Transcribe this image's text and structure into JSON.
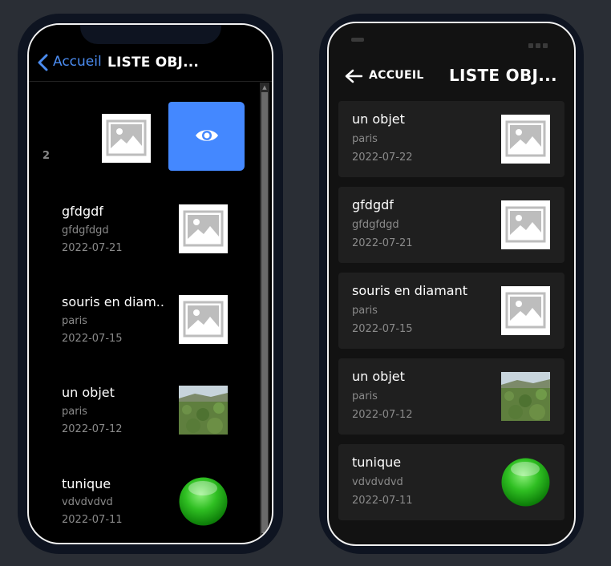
{
  "ios": {
    "back_label": "Accueil",
    "title": "LISTE OBJ...",
    "swipe_badge": "2",
    "items": [
      {
        "title": "gfdgdf",
        "subtitle": "gfdgfdgd",
        "date": "2022-07-21",
        "thumb": "placeholder-image"
      },
      {
        "title": "souris en diam...",
        "subtitle": "paris",
        "date": "2022-07-15",
        "thumb": "placeholder-image"
      },
      {
        "title": "un objet",
        "subtitle": "paris",
        "date": "2022-07-12",
        "thumb": "landscape-photo"
      },
      {
        "title": "tunique",
        "subtitle": "vdvdvdvd",
        "date": "2022-07-11",
        "thumb": "green-ball"
      }
    ],
    "swipe_icon": "eye-icon",
    "accent_color": "#4488ff"
  },
  "android": {
    "back_label": "ACCUEIL",
    "title": "LISTE OBJ...",
    "items": [
      {
        "title": "un objet",
        "subtitle": "paris",
        "date": "2022-07-22",
        "thumb": "placeholder-image"
      },
      {
        "title": "gfdgdf",
        "subtitle": "gfdgfdgd",
        "date": "2022-07-21",
        "thumb": "placeholder-image"
      },
      {
        "title": "souris en diamant",
        "subtitle": "paris",
        "date": "2022-07-15",
        "thumb": "placeholder-image"
      },
      {
        "title": "un objet",
        "subtitle": "paris",
        "date": "2022-07-12",
        "thumb": "landscape-photo"
      },
      {
        "title": "tunique",
        "subtitle": "vdvdvdvd",
        "date": "2022-07-11",
        "thumb": "green-ball"
      }
    ]
  }
}
